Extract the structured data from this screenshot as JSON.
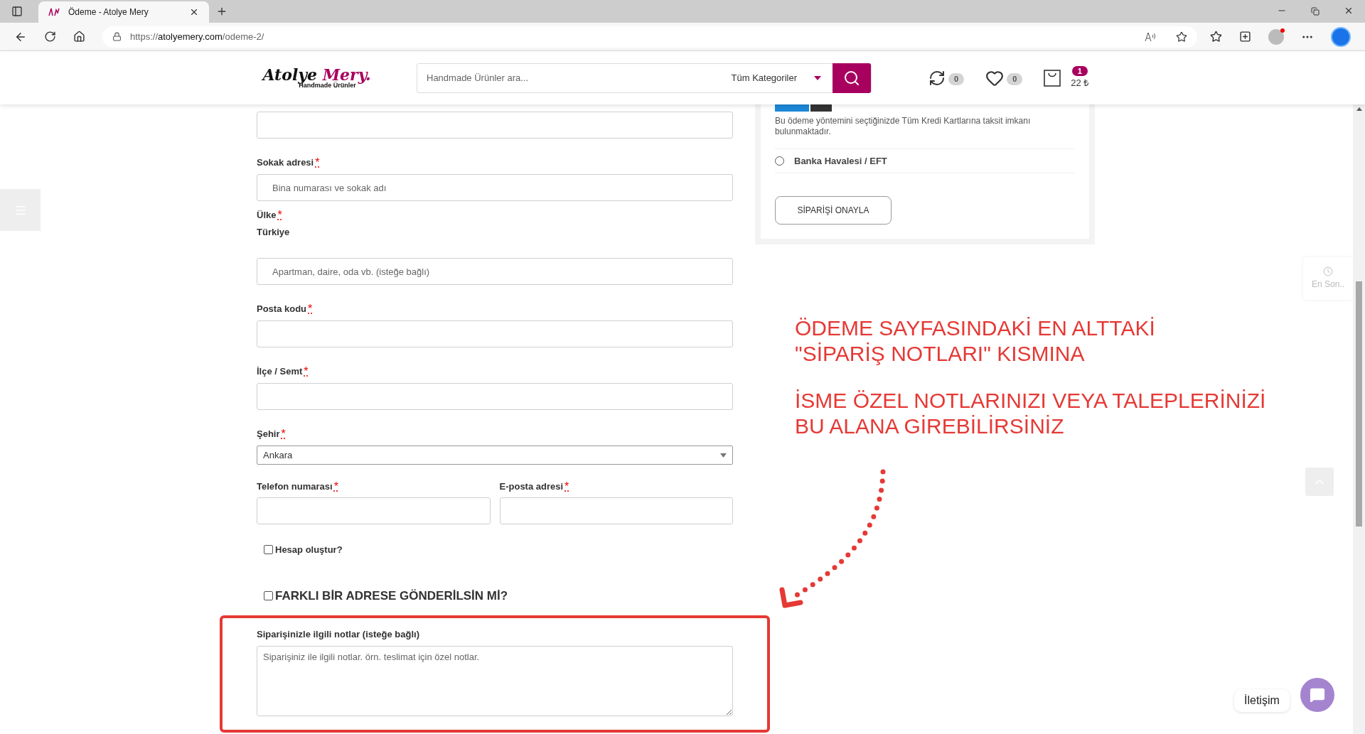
{
  "browser": {
    "tab_title": "Ödeme - Atolye Mery",
    "url": {
      "scheme": "https://",
      "domain": "atolyemery.com",
      "path": "/odeme-2/"
    }
  },
  "header": {
    "logo": {
      "first": "Atolye",
      "second": "Mery.",
      "tagline": "Handmade Ürünler"
    },
    "search": {
      "placeholder": "Handmade Ürünler ara...",
      "category": "Tüm Kategoriler"
    },
    "compare_count": "0",
    "wishlist_count": "0",
    "cart_count": "1",
    "cart_total": "22 ₺"
  },
  "form": {
    "fields": [
      {
        "kind": "text"
      },
      {
        "kind": "text",
        "label": "Sokak adresi",
        "mark": "*",
        "placeholder": "Bina numarası ve sokak adı"
      },
      {
        "kind": "static",
        "label": "Ülke",
        "mark": "*",
        "value": "Türkiye"
      },
      {
        "kind": "text",
        "placeholder": "Apartman, daire, oda vb. (isteğe bağlı)"
      },
      {
        "kind": "text",
        "label": "Posta kodu",
        "mark": "*"
      },
      {
        "kind": "text",
        "label": "İlçe / Semt",
        "mark": "*"
      },
      {
        "kind": "select",
        "label": "Şehir",
        "mark": "*",
        "value": "Ankara"
      },
      {
        "kind": "pair",
        "items": [
          {
            "label": "Telefon numarası",
            "mark": "*"
          },
          {
            "label": "E-posta adresi",
            "mark": "*"
          }
        ]
      },
      {
        "kind": "checkbox",
        "label": "Hesap oluştur?",
        "checked": false
      },
      {
        "kind": "heading_checkbox",
        "label": "FARKLI BİR ADRESE GÖNDERİLSİN Mİ?",
        "checked": false
      }
    ],
    "notes": {
      "label": "Siparişinizle ilgili notlar (isteğe bağlı)",
      "placeholder": "Siparişiniz ile ilgili notlar. örn. teslimat için özel notlar."
    }
  },
  "payment": {
    "description": "Bu ödeme yöntemini seçtiğinizde Tüm Kredi Kartlarına taksit imkanı bulunmaktadır.",
    "options": [
      {
        "label": "Banka Havalesi / EFT",
        "selected": false
      }
    ],
    "button": "SİPARİŞİ ONAYLA"
  },
  "annotation": {
    "paragraphs": [
      [
        "ÖDEME SAYFASINDAKİ EN ALTTAKİ",
        "\"SİPARİŞ NOTLARI\" KISMINA"
      ],
      [
        "İSME ÖZEL NOTLARINIZI VEYA TALEPLERİNİZİ",
        "BU ALANA GİREBİLİRSİNİZ"
      ]
    ]
  },
  "widgets": {
    "recent": "En Son..",
    "contact": "İletişim"
  }
}
